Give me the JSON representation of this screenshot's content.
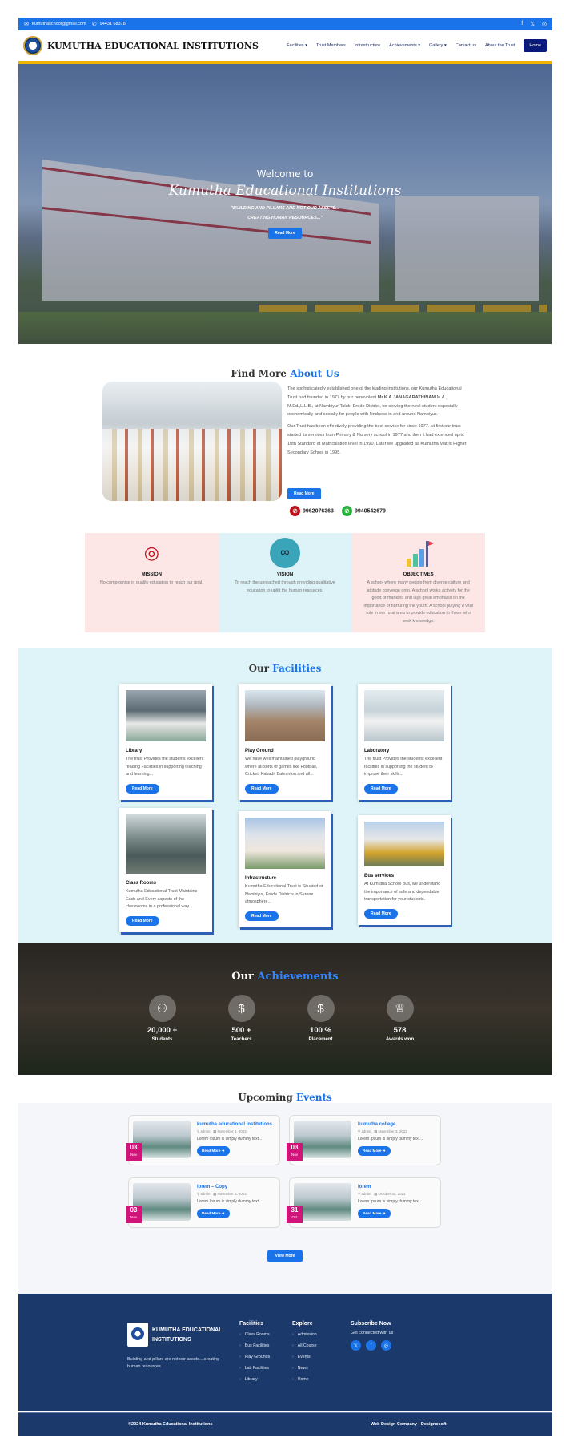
{
  "topbar": {
    "email": "kumuthaschool@gmail.com",
    "phone": "94431 68378",
    "social": [
      "f",
      "𝕏",
      "◎"
    ]
  },
  "header": {
    "brand": "KUMUTHA EDUCATIONAL INSTITUTIONS",
    "nav": [
      "Facilities ▾",
      "Trust Members",
      "Infrastructure",
      "Achievements ▾",
      "Gallery ▾",
      "Contact us",
      "About the Trust"
    ],
    "home": "Home"
  },
  "hero": {
    "welcome": "Welcome to",
    "title": "Kumutha Educational Institutions",
    "tagline1": "\"BUILDING AND PILLARS ARE NOT OUR ASSETS...",
    "tagline2": "CREATING HUMAN RESOURCES...\"",
    "button": "Read More"
  },
  "about": {
    "title_a": "Find More",
    "title_b": "About Us",
    "para1a": "The sophisticatedly established one of the leading institutions, our Kumutha Educational Trust had founded in 1977 by our benevolent",
    "para1b": "Mr.K.A.JANAGARATHINAM",
    "para1c": "M.A., M.Ed.,L.L.B., at Nambiyur Taluk, Erode District, for serving the rural student especially economically and socially for people with kindness in and around Nambiyur.",
    "para2": "Our Trust has been effectively providing the best service for since 1977. At first our trust started its services from Primary & Nursery school in 1977 and then it had extended up to 10th Standard at Matriculation level in 1990. Later we upgraded as Kumutha Matric Higher Secondary School in 1995.",
    "button": "Read More",
    "phone1": "9962076363",
    "phone2": "9940542679"
  },
  "mvo": [
    {
      "title": "MISSION",
      "text": "No compromise in quality education to reach our goal.",
      "bg": "#fde6e6",
      "icon": "target-icon"
    },
    {
      "title": "VISION",
      "text": "To reach the unreached through providing qualitative education to uplift the human resources.",
      "bg": "#def3f7",
      "icon": "binoculars-icon"
    },
    {
      "title": "OBJECTIVES",
      "text": "A school where many people from diverse culture and attitude converge onto. A school works actively for the good of mankind and lays great emphasis on the importance of nurturing the youth. A school playing a vital role in our rural area to provide education to those who seek knowledge.",
      "bg": "#fde6e6",
      "icon": "goal-chart-icon"
    }
  ],
  "facilities": {
    "title_a": "Our",
    "title_b": "Facilities",
    "cards": [
      {
        "title": "Library",
        "text": "The trust Provides the students excellent reading Facilities in supporting teaching and learning...",
        "button": "Read More"
      },
      {
        "title": "Play Ground",
        "text": "We have well maintained playground where all sorts of games like Football, Cricket, Kabadi, Batminton and all...",
        "button": "Read More"
      },
      {
        "title": "Laboratory",
        "text": "The trust Provides the students excellent facilities in supporting the student to improve their skills...",
        "button": "Read More"
      },
      {
        "title": "Class Rooms",
        "text": "Kumutha Educational Trust Maintains Each and Every aspects of the classrooms in a professional way...",
        "button": "Read More"
      },
      {
        "title": "Infrastructure",
        "text": "Kumutha Educational Trust is Situated at Nambiyur, Erode Districts in Serene atmosphere...",
        "button": "Read More"
      },
      {
        "title": "Bus services",
        "text": "At Kumutha School Bus, we understand the importance of safe and dependable transportation for your students.",
        "button": "Read More"
      }
    ]
  },
  "achievements": {
    "title_a": "Our",
    "title_b": "Achievements",
    "stats": [
      {
        "value": "20,000 +",
        "label": "Students",
        "icon": "students-icon"
      },
      {
        "value": "500 +",
        "label": "Teachers",
        "icon": "teacher-icon"
      },
      {
        "value": "100 %",
        "label": "Placement",
        "icon": "placement-icon"
      },
      {
        "value": "578",
        "label": "Awards won",
        "icon": "trophy-icon"
      }
    ]
  },
  "events": {
    "title_a": "Upcoming",
    "title_b": "Events",
    "items": [
      {
        "title": "kumutha educational institutions",
        "author": "admin",
        "date": "November 4, 2023",
        "excerpt": "Lorem Ipsum is simply dummy text...",
        "day": "03",
        "mon": "Nov",
        "button": "Read More ➔"
      },
      {
        "title": "kumutha college",
        "author": "admin",
        "date": "November 3, 2023",
        "excerpt": "Lorem Ipsum is simply dummy text...",
        "day": "03",
        "mon": "Nov",
        "button": "Read More ➔"
      },
      {
        "title": "lorem – Copy",
        "author": "admin",
        "date": "November 3, 2023",
        "excerpt": "Lorem Ipsum is simply dummy text...",
        "day": "03",
        "mon": "Nov",
        "button": "Read More ➔"
      },
      {
        "title": "lorem",
        "author": "admin",
        "date": "October 31, 2023",
        "excerpt": "Lorem Ipsum is simply dummy text...",
        "day": "31",
        "mon": "Oct",
        "button": "Read More ➔"
      }
    ],
    "view_more": "View More"
  },
  "footer": {
    "name": "KUMUTHA EDUCATIONAL INSTITUTIONS",
    "tagline": "Building and pillars are not our assets....creating human resources",
    "facilities_title": "Facilities",
    "facilities": [
      "Class Rooms",
      "Bus Facilities",
      "Play Grounds",
      "Lab Facilities",
      "Library"
    ],
    "explore_title": "Explore",
    "explore": [
      "Admission",
      "All Course",
      "Events",
      "News",
      "Home"
    ],
    "subscribe_title": "Subscribe Now",
    "subscribe_text": "Get connected with us",
    "social": [
      "𝕏",
      "f",
      "◎"
    ],
    "copyright": "©2024 Kumutha Educational Institutions",
    "credit": "Web Design Company - Designosoft"
  }
}
